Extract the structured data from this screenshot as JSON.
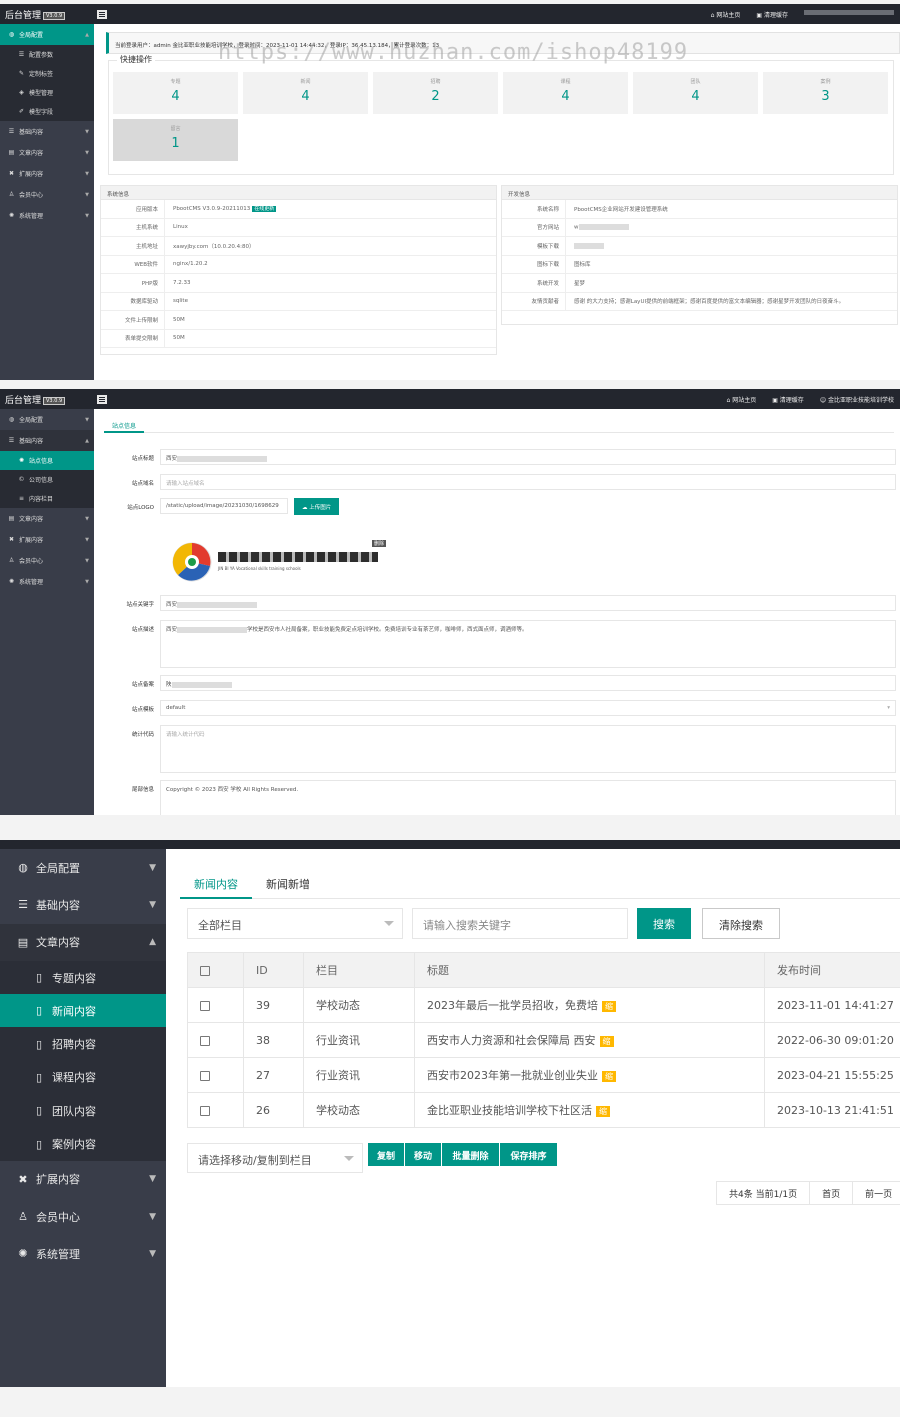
{
  "app": {
    "logo": "后台管理",
    "version": "V3.0.9",
    "top_links": [
      "网站主页",
      "清理缓存"
    ],
    "top_user": "金比亚职业技能培训学校",
    "watermark": "https://www.huzhan.com/ishop48199"
  },
  "shot1": {
    "sidebar": [
      {
        "label": "全局配置",
        "icon": "globe-icon",
        "open": true
      },
      {
        "label": "配置参数",
        "icon": "sliders-icon",
        "sub": true
      },
      {
        "label": "定制标签",
        "icon": "wrench-icon",
        "sub": true
      },
      {
        "label": "模型管理",
        "icon": "cube-icon",
        "sub": true
      },
      {
        "label": "模型字段",
        "icon": "edit-icon",
        "sub": true
      },
      {
        "label": "基础内容",
        "icon": "sliders-icon"
      },
      {
        "label": "文章内容",
        "icon": "doc-icon"
      },
      {
        "label": "扩展内容",
        "icon": "puzzle-icon"
      },
      {
        "label": "会员中心",
        "icon": "user-icon"
      },
      {
        "label": "系统管理",
        "icon": "gear-icon"
      }
    ],
    "notice": "当前登录用户：admin 金比亚职业技能培训学校，登录时间：2023-11-01 14:44:32，登录IP：36.45.13.184，累计登录次数：13",
    "quick_title": "快捷操作",
    "quick": [
      {
        "label": "专题",
        "value": "4"
      },
      {
        "label": "新闻",
        "value": "4"
      },
      {
        "label": "招聘",
        "value": "2"
      },
      {
        "label": "课程",
        "value": "4"
      },
      {
        "label": "团队",
        "value": "4"
      },
      {
        "label": "案例",
        "value": "3"
      },
      {
        "label": "留言",
        "value": "1"
      }
    ],
    "sys_title": "系统信息",
    "sys": [
      {
        "k": "应用版本",
        "v": "PbootCMS V3.0.9-20211013",
        "badge": "在线更新"
      },
      {
        "k": "主机系统",
        "v": "Linux"
      },
      {
        "k": "主机地址",
        "v": "xawyjby.com（10.0.20.4:80）"
      },
      {
        "k": "WEB软件",
        "v": "nginx/1.20.2"
      },
      {
        "k": "PHP版",
        "v": "7.2.33"
      },
      {
        "k": "数据库驱动",
        "v": "sqlite"
      },
      {
        "k": "文件上传限制",
        "v": "50M"
      },
      {
        "k": "表单提交限制",
        "v": "50M"
      }
    ],
    "dev_title": "开发信息",
    "dev": [
      {
        "k": "系统名称",
        "v": "PbootCMS企业网站开发建设管理系统"
      },
      {
        "k": "官方网站",
        "v": "w"
      },
      {
        "k": "模板下载",
        "v": ""
      },
      {
        "k": "图标下载",
        "v": "图标库"
      },
      {
        "k": "系统开发",
        "v": "星梦"
      },
      {
        "k": "友情贡献者",
        "v": "感谢  的大力支持；感谢LayUI提供的前端框架；感谢百度提供的富文本编辑器；感谢星梦开发团队的日夜奋斗。"
      }
    ]
  },
  "shot2": {
    "sidebar": [
      {
        "label": "全局配置",
        "icon": "globe-icon"
      },
      {
        "label": "基础内容",
        "icon": "sliders-icon",
        "open": true
      },
      {
        "label": "站点信息",
        "icon": "gear-icon",
        "sub": true,
        "active": true
      },
      {
        "label": "公司信息",
        "icon": "copyright-icon",
        "sub": true
      },
      {
        "label": "内容栏目",
        "icon": "list-icon",
        "sub": true
      },
      {
        "label": "文章内容",
        "icon": "doc-icon"
      },
      {
        "label": "扩展内容",
        "icon": "puzzle-icon"
      },
      {
        "label": "会员中心",
        "icon": "user-icon"
      },
      {
        "label": "系统管理",
        "icon": "gear-icon"
      }
    ],
    "tab": "站点信息",
    "fields": {
      "title_label": "站点标题",
      "title_value": "西安",
      "domain_label": "站点域名",
      "domain_placeholder": "请输入站点域名",
      "logo_label": "站点LOGO",
      "logo_value": "/static/upload/image/20231030/1698629",
      "upload_btn": "上传图片",
      "delete": "删除",
      "logo_sub": "JIN BI YA Vocational skills training schools",
      "keywords_label": "站点关键字",
      "keywords_value": "西安",
      "desc_label": "站点描述",
      "desc_value": "学校是西安市人社局备案，职业技能免费定点培训学校。免费培训专业有茶艺师，咖啡师，西式面点师，调酒师等。",
      "icp_label": "站点备案",
      "icp_value": "陕",
      "theme_label": "站点模板",
      "theme_value": "default",
      "stats_label": "统计代码",
      "stats_placeholder": "请输入统计代码",
      "footer_label": "尾部信息",
      "footer_value": "Copyright © 2023 西安  学校 All Rights Reserved."
    }
  },
  "shot3": {
    "sidebar": [
      {
        "label": "全局配置",
        "icon": "globe-icon"
      },
      {
        "label": "基础内容",
        "icon": "sliders-icon"
      },
      {
        "label": "文章内容",
        "icon": "doc-icon",
        "open": true
      },
      {
        "label": "专题内容",
        "icon": "file-icon",
        "sub": true
      },
      {
        "label": "新闻内容",
        "icon": "file-icon",
        "sub": true,
        "active": true
      },
      {
        "label": "招聘内容",
        "icon": "file-icon",
        "sub": true
      },
      {
        "label": "课程内容",
        "icon": "file-icon",
        "sub": true
      },
      {
        "label": "团队内容",
        "icon": "file-icon",
        "sub": true
      },
      {
        "label": "案例内容",
        "icon": "file-icon",
        "sub": true
      },
      {
        "label": "扩展内容",
        "icon": "puzzle-icon"
      },
      {
        "label": "会员中心",
        "icon": "user-icon"
      },
      {
        "label": "系统管理",
        "icon": "gear-icon"
      }
    ],
    "tabs": [
      "新闻内容",
      "新闻新增"
    ],
    "filter_select": "全部栏目",
    "search_placeholder": "请输入搜索关键字",
    "search_btn": "搜索",
    "clear_btn": "清除搜索",
    "columns": [
      "ID",
      "栏目",
      "标题",
      "发布时间"
    ],
    "rows": [
      {
        "id": "39",
        "cat": "学校动态",
        "title": "2023年最后一批学员招收，免费培",
        "tag": "缩",
        "time": "2023-11-01 14:41:27"
      },
      {
        "id": "38",
        "cat": "行业资讯",
        "title": "西安市人力资源和社会保障局 西安",
        "tag": "缩",
        "time": "2022-06-30 09:01:20"
      },
      {
        "id": "27",
        "cat": "行业资讯",
        "title": "西安市2023年第一批就业创业失业",
        "tag": "缩",
        "time": "2023-04-21 15:55:25"
      },
      {
        "id": "26",
        "cat": "学校动态",
        "title": "金比亚职业技能培训学校下社区活",
        "tag": "缩",
        "time": "2023-10-13 21:41:51"
      }
    ],
    "move_select": "请选择移动/复制到栏目",
    "actions": [
      "复制",
      "移动",
      "批量删除",
      "保存排序"
    ],
    "pager": [
      "共4条 当前1/1页",
      "首页",
      "前一页"
    ]
  }
}
